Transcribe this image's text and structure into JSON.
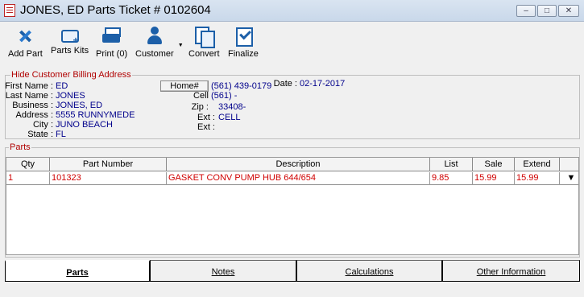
{
  "window": {
    "title": "JONES, ED Parts Ticket # 0102604",
    "controls": {
      "minimize": "–",
      "maximize": "□",
      "close": "✕"
    }
  },
  "toolbar": {
    "add_part": "Add Part",
    "parts_kits": "Parts Kits",
    "print": "Print (0)",
    "customer": "Customer",
    "convert": "Convert",
    "finalize": "Finalize"
  },
  "billing": {
    "legend": "Hide Customer Billing Address",
    "labels": {
      "first_name": "First Name :",
      "last_name": "Last Name :",
      "business": "Business :",
      "address": "Address :",
      "city": "City :",
      "state": "State :",
      "home_button": "Home#",
      "cell": "Cell",
      "zip": "Zip :",
      "ext1": "Ext :",
      "ext2": "Ext :",
      "date": "Date :"
    },
    "values": {
      "first_name": "ED",
      "last_name": "JONES",
      "business": "JONES, ED",
      "address": "5555 RUNNYMEDE",
      "city": "JUNO BEACH",
      "state": "FL",
      "home_phone": "(561) 439-0179",
      "cell_phone": "(561)    -",
      "zip": "33408-",
      "ext1": "CELL",
      "ext2": "",
      "date": "02-17-2017"
    }
  },
  "parts": {
    "legend": "Parts",
    "columns": [
      "Qty",
      "Part Number",
      "Description",
      "List",
      "Sale",
      "Extend"
    ],
    "rows": [
      {
        "qty": "1",
        "part_number": "101323",
        "description": "GASKET CONV PUMP HUB 644/654",
        "list": "9.85",
        "sale": "15.99",
        "extend": "15.99"
      }
    ]
  },
  "tabs": [
    "Parts",
    "Notes",
    "Calculations",
    "Other Information"
  ],
  "colors": {
    "accent": "#1c5fa8",
    "legend_red": "#b00000",
    "value_blue": "#00008b",
    "row_red": "#d00000"
  }
}
